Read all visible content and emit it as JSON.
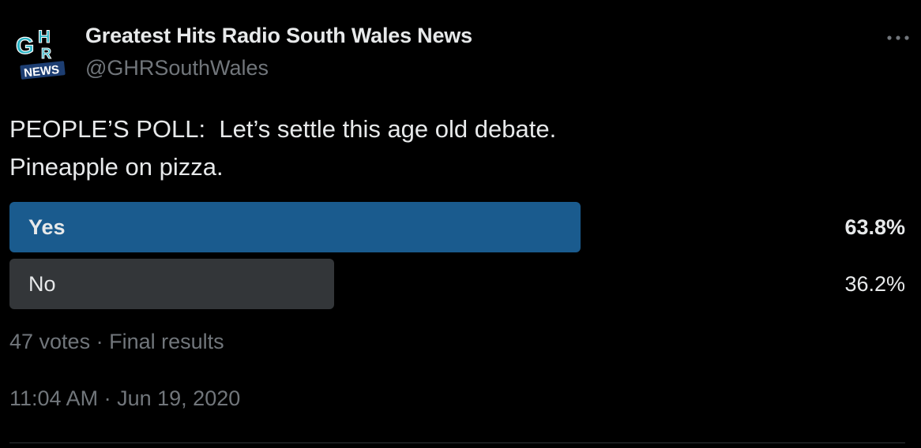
{
  "author": {
    "name": "Greatest Hits Radio South Wales News",
    "handle": "@GHRSouthWales",
    "avatar_letters": [
      "G",
      "H",
      "R"
    ],
    "avatar_caption": "NEWS"
  },
  "tweet": {
    "text_lines": [
      "PEOPLE’S POLL:  Let’s settle this age old debate.",
      "Pineapple on pizza."
    ]
  },
  "poll": {
    "options": [
      {
        "label": "Yes",
        "percent_text": "63.8%",
        "percent": 63.8,
        "color": "#1a5b8e",
        "winner": true
      },
      {
        "label": "No",
        "percent_text": "36.2%",
        "percent": 36.2,
        "color": "#333639",
        "winner": false
      }
    ],
    "votes_text": "47 votes",
    "separator": "·",
    "status_text": "Final results"
  },
  "timestamp": {
    "time": "11:04 AM",
    "separator": "·",
    "date": "Jun 19, 2020"
  },
  "colors": {
    "background": "#000000",
    "text_primary": "#e7e9ea",
    "text_secondary": "#71767b",
    "avatar_teal": "#2ab3c4",
    "avatar_navy": "#1d3e72"
  },
  "icons": {
    "more": "more-horizontal-icon"
  }
}
